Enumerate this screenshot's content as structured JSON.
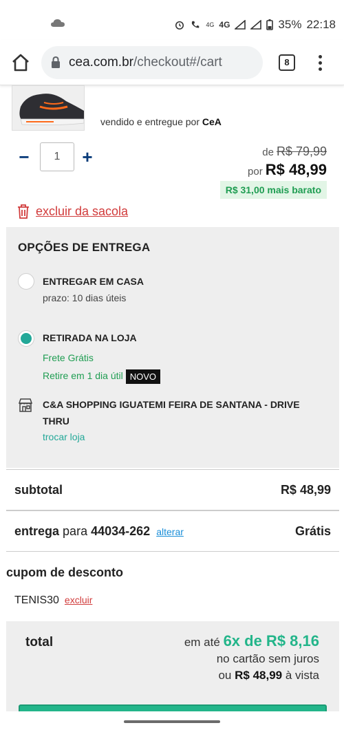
{
  "status_bar": {
    "battery": "35%",
    "time": "22:18",
    "network_a": "4G",
    "network_b": "4G"
  },
  "browser": {
    "url_host": "cea.com.br",
    "url_path": "/checkout#/cart",
    "tab_count": "8"
  },
  "product": {
    "seller_prefix": "vendido e entregue por",
    "seller_name": "CeA",
    "quantity": "1",
    "qty_minus": "−",
    "qty_plus": "+",
    "price_old_prefix": "de",
    "price_old": "R$ 79,99",
    "price_new_prefix": "por",
    "price_new": "R$ 48,99",
    "saving": "R$ 31,00 mais barato",
    "remove_label": "excluir da sacola"
  },
  "delivery": {
    "title": "OPÇÕES DE ENTREGA",
    "option_home": {
      "label": "ENTREGAR EM CASA",
      "detail": "prazo: 10 dias úteis",
      "selected": false
    },
    "option_store": {
      "label": "RETIRADA NA LOJA",
      "free": "Frete Grátis",
      "pickup": "Retire em 1 dia útil",
      "badge": "NOVO",
      "selected": true
    },
    "store_name": "C&A SHOPPING IGUATEMI FEIRA DE SANTANA - DRIVE THRU",
    "change_store": "trocar loja"
  },
  "summary": {
    "subtotal_label": "subtotal",
    "subtotal_value": "R$ 48,99",
    "delivery_label": "entrega",
    "delivery_for": "para",
    "cep": "44034-262",
    "alter_label": "alterar",
    "delivery_value": "Grátis"
  },
  "coupon": {
    "title": "cupom de desconto",
    "code": "TENIS30",
    "remove": "excluir"
  },
  "total": {
    "label": "total",
    "installments_prefix": "em até",
    "installments": "6x de R$ 8,16",
    "no_interest": "no cartão sem juros",
    "cash_prefix": "ou",
    "cash_value": "R$ 48,99",
    "cash_suffix": "à vista"
  },
  "colors": {
    "accent_teal": "#23a898",
    "green": "#1f9d52",
    "remove_red": "#d13b3b",
    "qty_blue": "#0a3c7a"
  }
}
